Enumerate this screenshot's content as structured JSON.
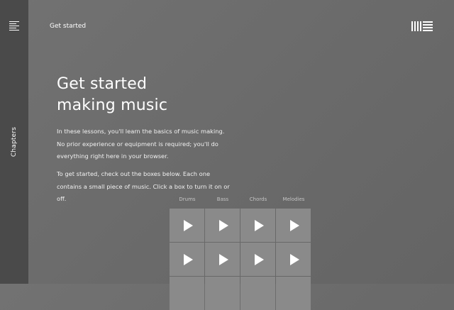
{
  "sidebar": {
    "label": "Chapters",
    "menu_icon": "hamburger-menu-icon"
  },
  "header": {
    "title": "Get started",
    "logo_icon": "ableton-logo-icon"
  },
  "hero": {
    "title_line1": "Get started",
    "title_line2": "making music"
  },
  "intro": {
    "paragraph1": "In these lessons, you'll learn the basics of music making. No prior experience or equipment is required; you'll do everything right here in your browser.",
    "paragraph2": "To get started, check out the boxes below. Each one contains a small piece of music. Click a box to turn it on or off."
  },
  "grid": {
    "columns": [
      "Drums",
      "Bass",
      "Chords",
      "Melodies"
    ],
    "rows_visible": 3,
    "cell_icon": "play-icon",
    "cell_color": "#8a8a8a"
  },
  "colors": {
    "sidebar": "#4a4a4a",
    "background": "#6e6e6e",
    "text": "#ffffff"
  }
}
